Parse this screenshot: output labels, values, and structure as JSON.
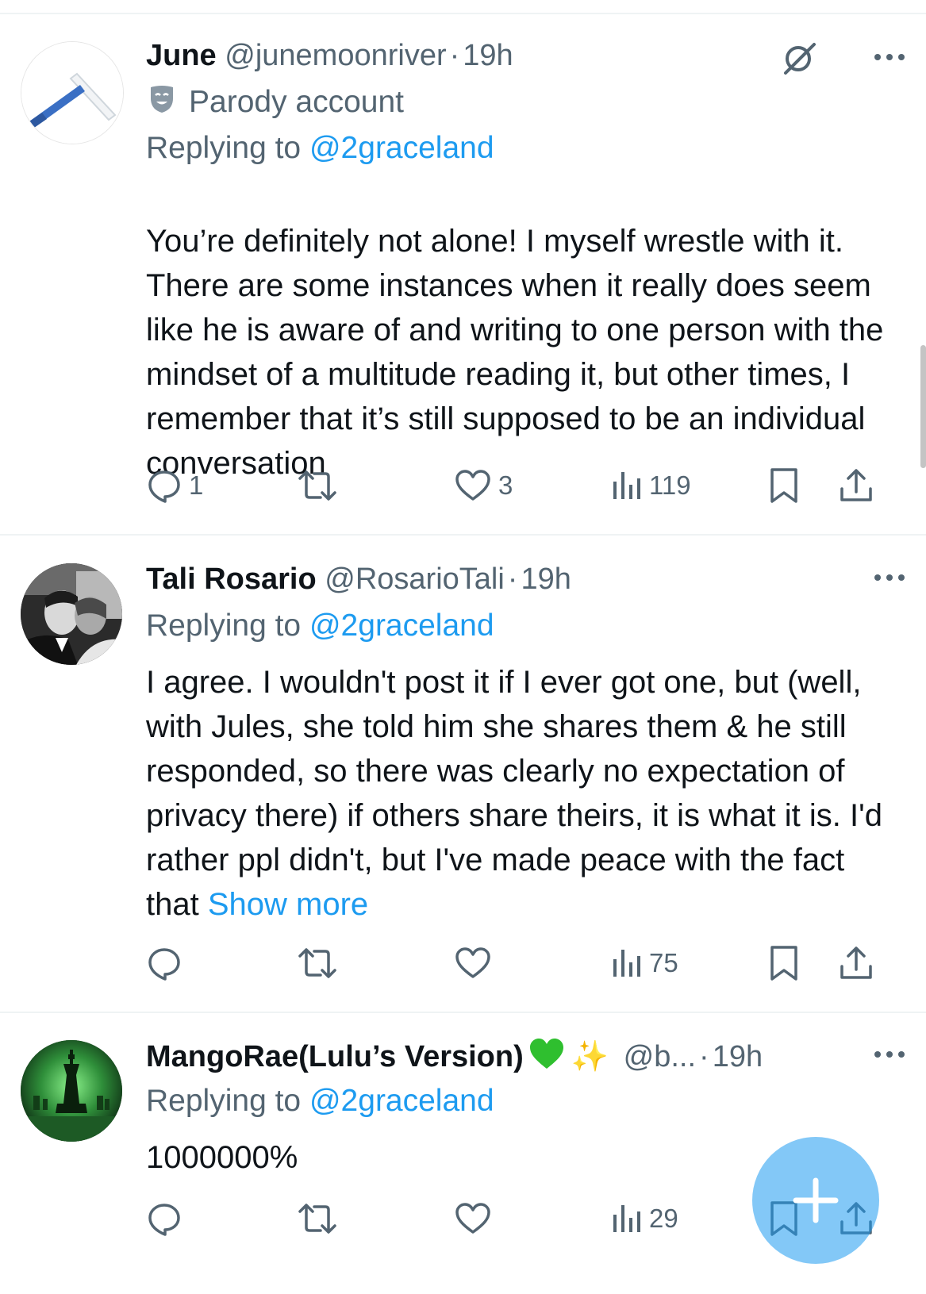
{
  "tweets": [
    {
      "name": "June",
      "handle": "@junemoonriver",
      "separator": "·",
      "time": "19h",
      "badge": "Parody account",
      "replying_prefix": "Replying to",
      "replying_to": "@2graceland",
      "text": "You’re definitely not alone! I myself wrestle with it. There are some instances when it really does seem like he is aware of and writing to one person with the mindset of a multitude reading it, but other times, I remember that it’s still supposed to be an individual conversation",
      "replies": "1",
      "reposts": "",
      "likes": "3",
      "views": "119"
    },
    {
      "name": "Tali Rosario",
      "handle": "@RosarioTali",
      "separator": "·",
      "time": "19h",
      "replying_prefix": "Replying to",
      "replying_to": "@2graceland",
      "text": "I agree. I wouldn't post it if I ever got one, but (well, with Jules, she told him she shares them & he still responded, so there was clearly no expectation of privacy there) if others share theirs, it is what it is. I'd rather ppl didn't, but I've made peace with the fact that",
      "show_more": "Show more",
      "replies": "",
      "reposts": "",
      "likes": "",
      "views": "75"
    },
    {
      "name": "MangoRae(Lulu’s Version)",
      "emoji_sparkle": "✨",
      "handle": "@b...",
      "separator": "·",
      "time": "19h",
      "replying_prefix": "Replying to",
      "replying_to": "@2graceland",
      "text": "1000000%",
      "replies": "",
      "reposts": "",
      "likes": "",
      "views": "29"
    }
  ],
  "colors": {
    "text_primary": "#0f1419",
    "text_secondary": "#536471",
    "link": "#1d9bf0",
    "divider": "#eff3f4",
    "heart_green": "#2fbf2f"
  },
  "icons": {
    "more": "more-horizontal-icon",
    "grok": "grok-icon",
    "parody": "parody-mask-icon",
    "reply": "reply-icon",
    "repost": "repost-icon",
    "like": "like-icon",
    "views": "views-icon",
    "bookmark": "bookmark-icon",
    "share": "share-icon",
    "compose": "compose-plus-icon"
  }
}
